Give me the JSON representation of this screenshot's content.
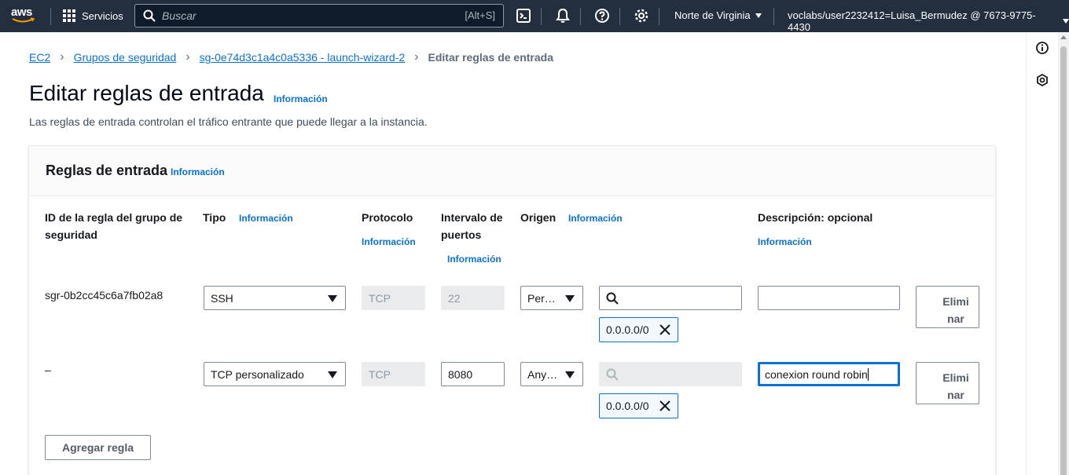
{
  "nav": {
    "logo_text": "aws",
    "services_label": "Servicios",
    "search_placeholder": "Buscar",
    "search_shortcut": "[Alt+S]",
    "region": "Norte de Virginia",
    "account": "voclabs/user2232412=Luisa_Bermudez @ 7673-9775-4430"
  },
  "breadcrumb": {
    "items": [
      "EC2",
      "Grupos de seguridad",
      "sg-0e74d3c1a4c0a5336 - launch-wizard-2"
    ],
    "current": "Editar reglas de entrada"
  },
  "page": {
    "title": "Editar reglas de entrada",
    "info": "Información",
    "description": "Las reglas de entrada controlan el tráfico entrante que puede llegar a la instancia."
  },
  "panel": {
    "title": "Reglas de entrada",
    "info": "Información",
    "columns": {
      "rule_id": "ID de la regla del grupo de seguridad",
      "type": "Tipo",
      "protocol": "Protocolo",
      "port_range": "Intervalo de puertos",
      "source": "Origen",
      "description": "Descripción: opcional"
    },
    "rules": [
      {
        "id": "sgr-0b2cc45c6a7fb02a8",
        "type": "SSH",
        "protocol": "TCP",
        "port": "22",
        "source_mode": "Per…",
        "source_search": "",
        "cidr": "0.0.0.0/0",
        "description": "",
        "delete_label": "Elimi nar"
      },
      {
        "id": "–",
        "type": "TCP personalizado",
        "protocol": "TCP",
        "port": "8080",
        "source_mode": "Any…",
        "source_search": "",
        "cidr": "0.0.0.0/0",
        "description": "conexion round robin",
        "delete_label": "Elimi nar"
      }
    ],
    "add_rule_label": "Agregar regla"
  }
}
